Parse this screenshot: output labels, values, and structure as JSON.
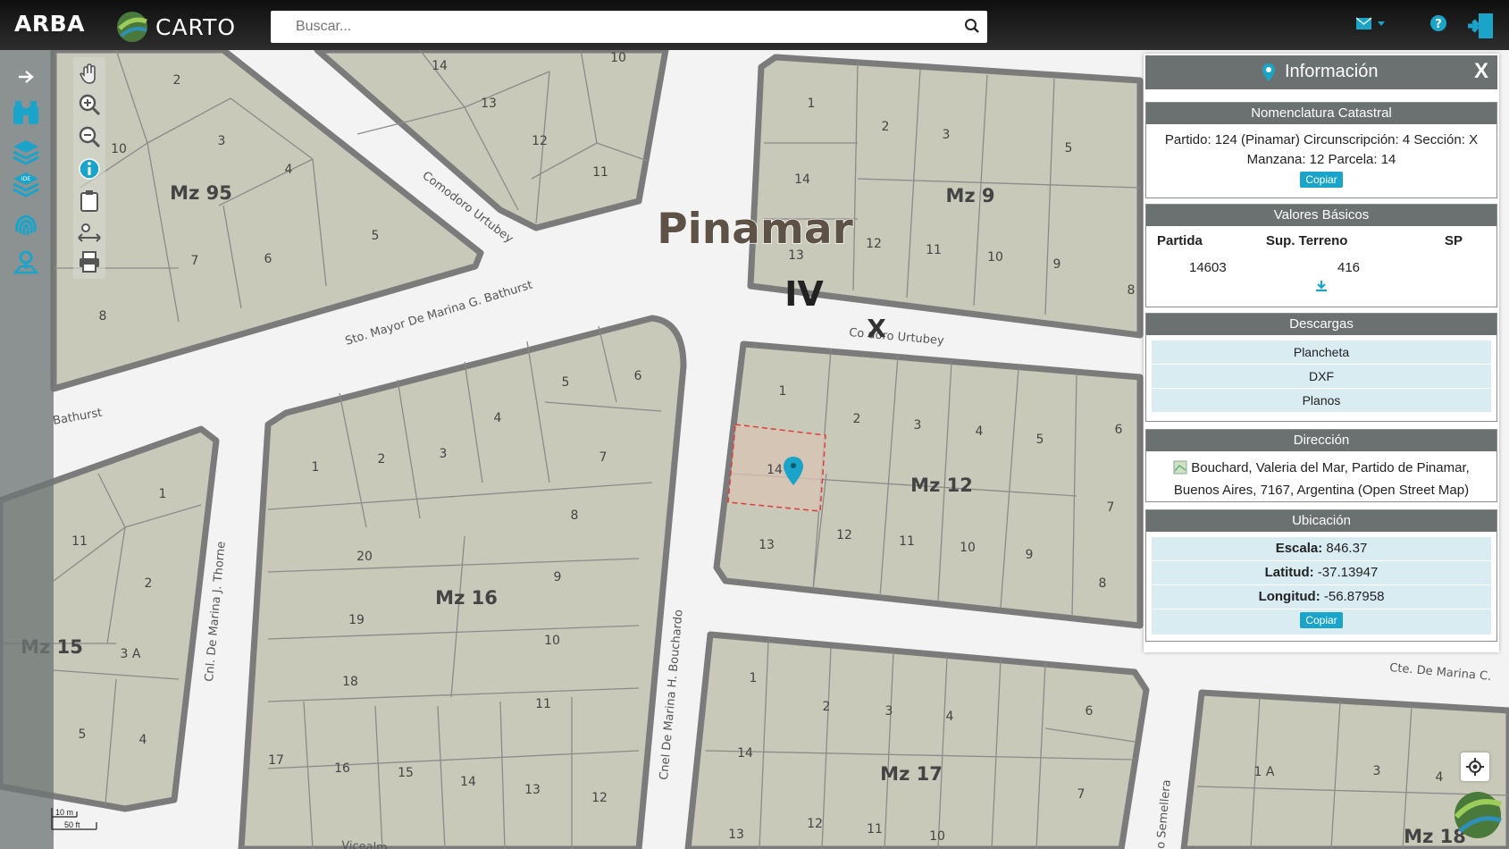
{
  "header": {
    "brand": "ARBA",
    "carto": "CARTO",
    "search_placeholder": "Buscar..."
  },
  "icons": {
    "search": "search-icon",
    "mail": "envelope-icon",
    "help": "question-icon",
    "exit": "sign-out-icon"
  },
  "map": {
    "city_label": "Pinamar",
    "circ_label": "IV",
    "sec_label": "X",
    "blocks": [
      "Mz 95",
      "Mz 9",
      "Mz 12",
      "Mz 16",
      "Mz 15",
      "Mz 17",
      "Mz 18"
    ],
    "streets": [
      "Comodoro Urtubey",
      "Sto. Mayor De Marina G. Bathurst",
      "Bathurst",
      "Co  doro Urtubey",
      "Cnl. De Marina J. Thorne",
      "Cnel De Marina H. Bouchardo",
      "Cte. De Marina C.",
      "o Semellera",
      "Vicealm"
    ],
    "scale_m": "10 m",
    "scale_ft": "50 ft"
  },
  "panel": {
    "title": "Información",
    "close": "X",
    "nomenclatura": {
      "header": "Nomenclatura Catastral",
      "line1": "Partido: 124 (Pinamar) Circunscripción: 4 Sección: X",
      "line2": "Manzana: 12 Parcela: 14",
      "copy": "Copiar"
    },
    "valores": {
      "header": "Valores Básicos",
      "col1": "Partida",
      "col2": "Sup. Terreno",
      "col3": "SP",
      "partida": "14603",
      "sup": "416"
    },
    "descargas": {
      "header": "Descargas",
      "items": [
        "Plancheta",
        "DXF",
        "Planos"
      ]
    },
    "direccion": {
      "header": "Dirección",
      "text": "Bouchard, Valeria del Mar, Partido de Pinamar, Buenos Aires, 7167, Argentina (Open Street Map)"
    },
    "ubicacion": {
      "header": "Ubicación",
      "escala_label": "Escala:",
      "escala": "846.37",
      "lat_label": "Latitud:",
      "lat": "-37.13947",
      "lon_label": "Longitud:",
      "lon": "-56.87958",
      "copy": "Copiar"
    }
  },
  "colors": {
    "block_fill": "#c8c9b8",
    "block_stroke": "#7b7b7b",
    "street": "#f4f4f4",
    "accent": "#1ba4c9",
    "panel_header": "#6b7170",
    "selected_parcel": "#d9c3b4"
  }
}
